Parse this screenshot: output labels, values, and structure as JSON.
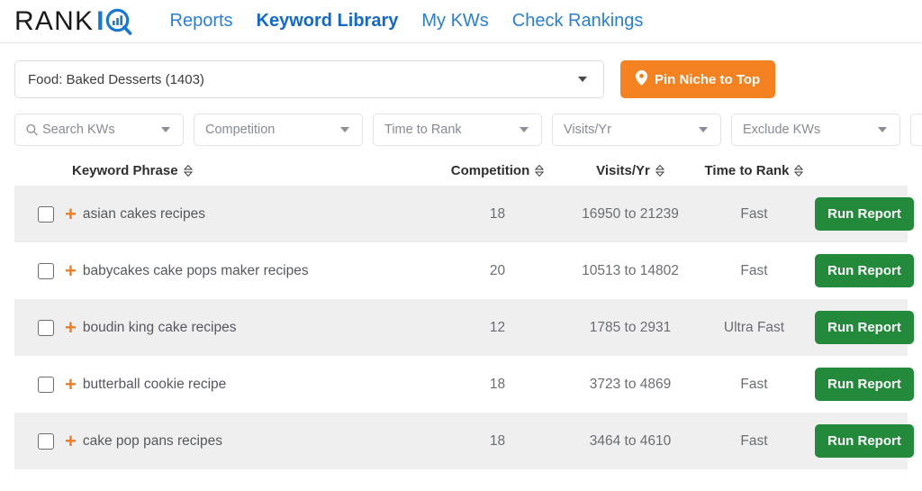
{
  "brand": {
    "name_dark": "RANK",
    "name_i": "I",
    "logo_icon": "magnifier-bar-chart-icon",
    "dark_color": "#1a1a1a",
    "blue_color": "#1877d2"
  },
  "nav": {
    "items": [
      {
        "label": "Reports",
        "active": false
      },
      {
        "label": "Keyword Library",
        "active": true
      },
      {
        "label": "My KWs",
        "active": false
      },
      {
        "label": "Check Rankings",
        "active": false
      }
    ],
    "link_color": "#2a7fd4",
    "active_color": "#1268cc"
  },
  "niche": {
    "selected": "Food: Baked Desserts (1403)",
    "pin_button": "Pin Niche to Top",
    "pin_icon": "map-pin-icon",
    "pin_color": "#f58220"
  },
  "filters": [
    {
      "placeholder": "Search KWs",
      "icon": "search-icon",
      "name": "search-kws-filter"
    },
    {
      "placeholder": "Competition",
      "icon": "",
      "name": "competition-filter"
    },
    {
      "placeholder": "Time to Rank",
      "icon": "",
      "name": "time-to-rank-filter"
    },
    {
      "placeholder": "Visits/Yr",
      "icon": "",
      "name": "visits-per-year-filter"
    },
    {
      "placeholder": "Exclude KWs",
      "icon": "",
      "name": "exclude-kws-filter"
    }
  ],
  "table": {
    "headers": {
      "keyword": "Keyword Phrase",
      "competition": "Competition",
      "visits": "Visits/Yr",
      "time_to_rank": "Time to Rank"
    },
    "sort_icon": "sort-updown-icon",
    "action_label": "Run Report",
    "action_color": "#238a3c",
    "expand_icon": "plus-icon",
    "rows": [
      {
        "keyword": "asian cakes recipes",
        "competition": "18",
        "visits": "16950 to 21239",
        "time_to_rank": "Fast",
        "action": "Run Report",
        "checked": false
      },
      {
        "keyword": "babycakes cake pops maker recipes",
        "competition": "20",
        "visits": "10513 to 14802",
        "time_to_rank": "Fast",
        "action": "Run Report",
        "checked": false
      },
      {
        "keyword": "boudin king cake recipes",
        "competition": "12",
        "visits": "1785 to 2931",
        "time_to_rank": "Ultra Fast",
        "action": "Run Report",
        "checked": false
      },
      {
        "keyword": "butterball cookie recipe",
        "competition": "18",
        "visits": "3723 to 4869",
        "time_to_rank": "Fast",
        "action": "Run Report",
        "checked": false
      },
      {
        "keyword": "cake pop pans recipes",
        "competition": "18",
        "visits": "3464 to 4610",
        "time_to_rank": "Fast",
        "action": "Run Report",
        "checked": false
      }
    ]
  }
}
